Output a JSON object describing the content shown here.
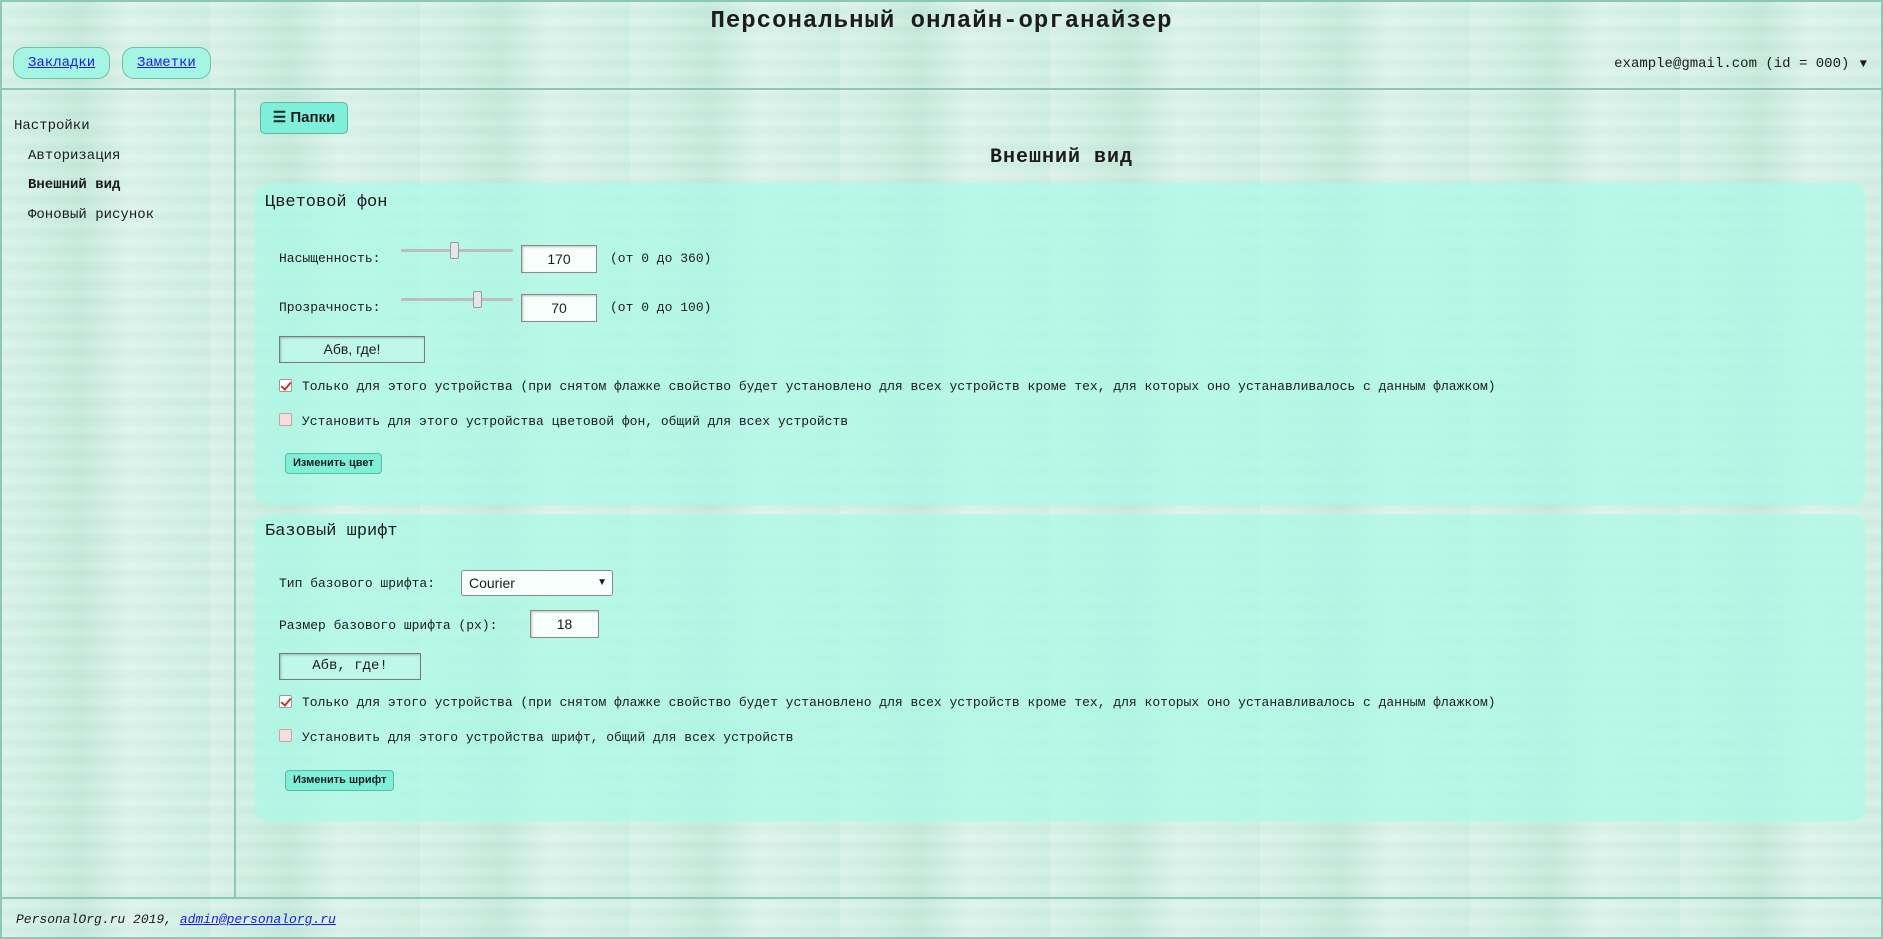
{
  "header": {
    "title": "Персональный онлайн-органайзер",
    "nav": {
      "bookmarks": "Закладки",
      "notes": "Заметки"
    },
    "user": "example@gmail.com (id = 000)",
    "user_caret": "▼"
  },
  "sidebar": {
    "heading": "Настройки",
    "items": [
      {
        "label": "Авторизация",
        "active": false
      },
      {
        "label": "Внешний вид",
        "active": true
      },
      {
        "label": "Фоновый рисунок",
        "active": false
      }
    ]
  },
  "main": {
    "folders_button": "☰ Папки",
    "page_title": "Внешний вид",
    "color_panel": {
      "title": "Цветовой фон",
      "saturation_label": "Насыщенность:",
      "saturation_value": "170",
      "saturation_fraction": 0.472,
      "saturation_range": "(от 0 до 360)",
      "opacity_label": "Прозрачность:",
      "opacity_value": "70",
      "opacity_fraction": 0.7,
      "opacity_range": "(от 0 до 100)",
      "preview_text": "Абв, где!",
      "device_only_label": "Только для этого устройства (при снятом флажке свойство будет установлено для всех устройств кроме тех, для которых оно устанавливалось с данным флажком)",
      "device_only_checked": true,
      "set_common_label": "Установить для этого устройства цветовой фон, общий для всех устройств",
      "set_common_checked": false,
      "change_button": "Изменить цвет"
    },
    "font_panel": {
      "title": "Базовый шрифт",
      "font_type_label": "Тип базового шрифта:",
      "font_type_value": "Courier",
      "font_size_label": "Размер базового шрифта (px):",
      "font_size_value": "18",
      "preview_text": "Абв, где!",
      "device_only_label": "Только для этого устройства (при снятом флажке свойство будет установлено для всех устройств кроме тех, для которых оно устанавливалось с данным флажком)",
      "device_only_checked": true,
      "set_common_label": "Установить для этого устройства шрифт, общий для всех устройств",
      "set_common_checked": false,
      "change_button": "Изменить шрифт"
    }
  },
  "footer": {
    "text": "PersonalOrg.ru 2019, ",
    "email": "admin@personalorg.ru"
  }
}
